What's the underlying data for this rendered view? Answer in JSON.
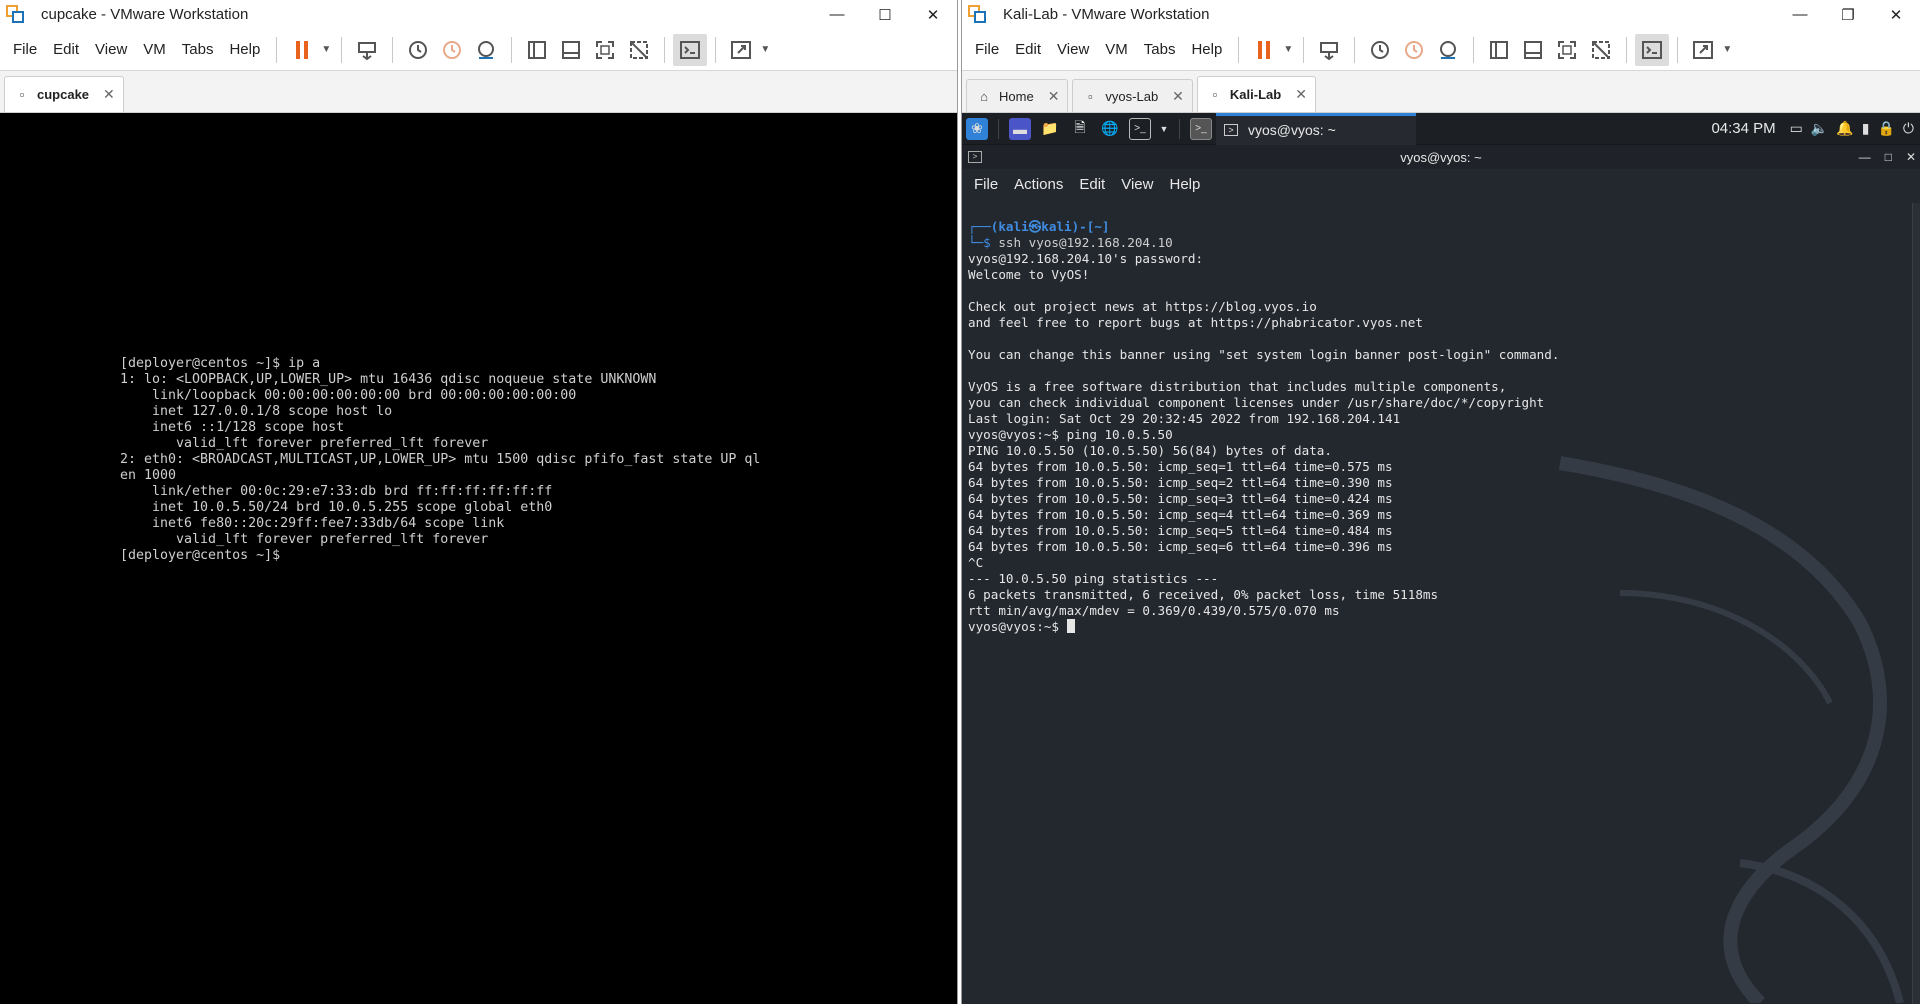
{
  "left_window": {
    "title": "cupcake - VMware Workstation",
    "menu": [
      "File",
      "Edit",
      "View",
      "VM",
      "Tabs",
      "Help"
    ],
    "tabs": [
      {
        "label": "cupcake"
      }
    ],
    "console_lines": [
      "[deployer@centos ~]$ ip a",
      "1: lo: <LOOPBACK,UP,LOWER_UP> mtu 16436 qdisc noqueue state UNKNOWN",
      "    link/loopback 00:00:00:00:00:00 brd 00:00:00:00:00:00",
      "    inet 127.0.0.1/8 scope host lo",
      "    inet6 ::1/128 scope host",
      "       valid_lft forever preferred_lft forever",
      "2: eth0: <BROADCAST,MULTICAST,UP,LOWER_UP> mtu 1500 qdisc pfifo_fast state UP ql",
      "en 1000",
      "    link/ether 00:0c:29:e7:33:db brd ff:ff:ff:ff:ff:ff",
      "    inet 10.0.5.50/24 brd 10.0.5.255 scope global eth0",
      "    inet6 fe80::20c:29ff:fee7:33db/64 scope link",
      "       valid_lft forever preferred_lft forever",
      "[deployer@centos ~]$"
    ]
  },
  "right_window": {
    "title": "Kali-Lab - VMware Workstation",
    "menu": [
      "File",
      "Edit",
      "View",
      "VM",
      "Tabs",
      "Help"
    ],
    "tabs": [
      {
        "label": "Home"
      },
      {
        "label": "vyos-Lab"
      },
      {
        "label": "Kali-Lab"
      }
    ],
    "kali": {
      "task_label": "vyos@vyos: ~",
      "clock": "04:34 PM",
      "terminal_title": "vyos@vyos: ~",
      "terminal_menu": [
        "File",
        "Actions",
        "Edit",
        "View",
        "Help"
      ],
      "prompt_user": "(kali㉿kali)-[~]",
      "prompt_cmd": "ssh vyos@192.168.204.10",
      "output_lines": [
        "vyos@192.168.204.10's password:",
        "Welcome to VyOS!",
        "",
        "Check out project news at https://blog.vyos.io",
        "and feel free to report bugs at https://phabricator.vyos.net",
        "",
        "You can change this banner using \"set system login banner post-login\" command.",
        "",
        "VyOS is a free software distribution that includes multiple components,",
        "you can check individual component licenses under /usr/share/doc/*/copyright",
        "Last login: Sat Oct 29 20:32:45 2022 from 192.168.204.141",
        "vyos@vyos:~$ ping 10.0.5.50",
        "PING 10.0.5.50 (10.0.5.50) 56(84) bytes of data.",
        "64 bytes from 10.0.5.50: icmp_seq=1 ttl=64 time=0.575 ms",
        "64 bytes from 10.0.5.50: icmp_seq=2 ttl=64 time=0.390 ms",
        "64 bytes from 10.0.5.50: icmp_seq=3 ttl=64 time=0.424 ms",
        "64 bytes from 10.0.5.50: icmp_seq=4 ttl=64 time=0.369 ms",
        "64 bytes from 10.0.5.50: icmp_seq=5 ttl=64 time=0.484 ms",
        "64 bytes from 10.0.5.50: icmp_seq=6 ttl=64 time=0.396 ms",
        "^C",
        "--- 10.0.5.50 ping statistics ---",
        "6 packets transmitted, 6 received, 0% packet loss, time 5118ms",
        "rtt min/avg/max/mdev = 0.369/0.439/0.575/0.070 ms"
      ],
      "final_prompt": "vyos@vyos:~$ "
    }
  }
}
